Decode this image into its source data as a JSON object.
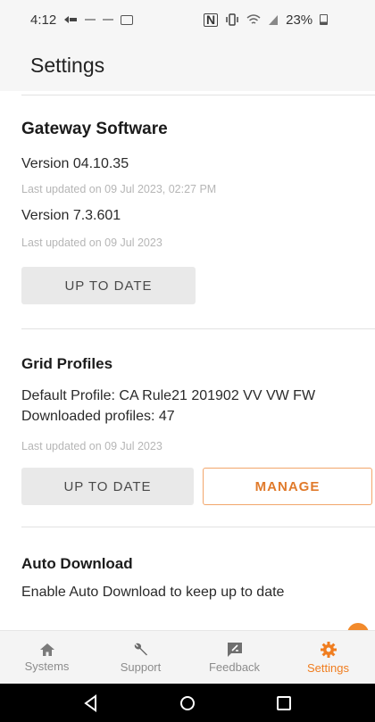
{
  "status_bar": {
    "time": "4:12",
    "nfc": "N",
    "battery": "23%",
    "icons": [
      "notification-icon",
      "dash-icon",
      "dash-icon",
      "image-icon",
      "nfc-icon",
      "vibrate-icon",
      "wifi-icon",
      "signal-icon",
      "battery-icon"
    ]
  },
  "header": {
    "title": "Settings"
  },
  "gateway": {
    "title": "Gateway Software",
    "version1": "Version 04.10.35",
    "updated1": "Last updated on 09 Jul 2023, 02:27 PM",
    "version2": "Version 7.3.601",
    "updated2": "Last updated on 09 Jul 2023",
    "button": "UP TO DATE"
  },
  "grid": {
    "title": "Grid Profiles",
    "default_profile": "Default Profile: CA Rule21 201902 VV VW FW",
    "downloaded": "Downloaded profiles: 47",
    "updated": "Last updated on 09 Jul 2023",
    "button_status": "UP TO DATE",
    "button_manage": "MANAGE"
  },
  "auto_download": {
    "title": "Auto Download",
    "description": "Enable Auto Download to keep up to date"
  },
  "bottom_nav": [
    {
      "label": "Systems",
      "icon": "home-icon",
      "active": false
    },
    {
      "label": "Support",
      "icon": "wrench-icon",
      "active": false
    },
    {
      "label": "Feedback",
      "icon": "feedback-icon",
      "active": false
    },
    {
      "label": "Settings",
      "icon": "gear-icon",
      "active": true
    }
  ],
  "colors": {
    "accent": "#f07d1f",
    "muted_text": "#b6b6b6",
    "button_grey": "#e9e9e9"
  }
}
